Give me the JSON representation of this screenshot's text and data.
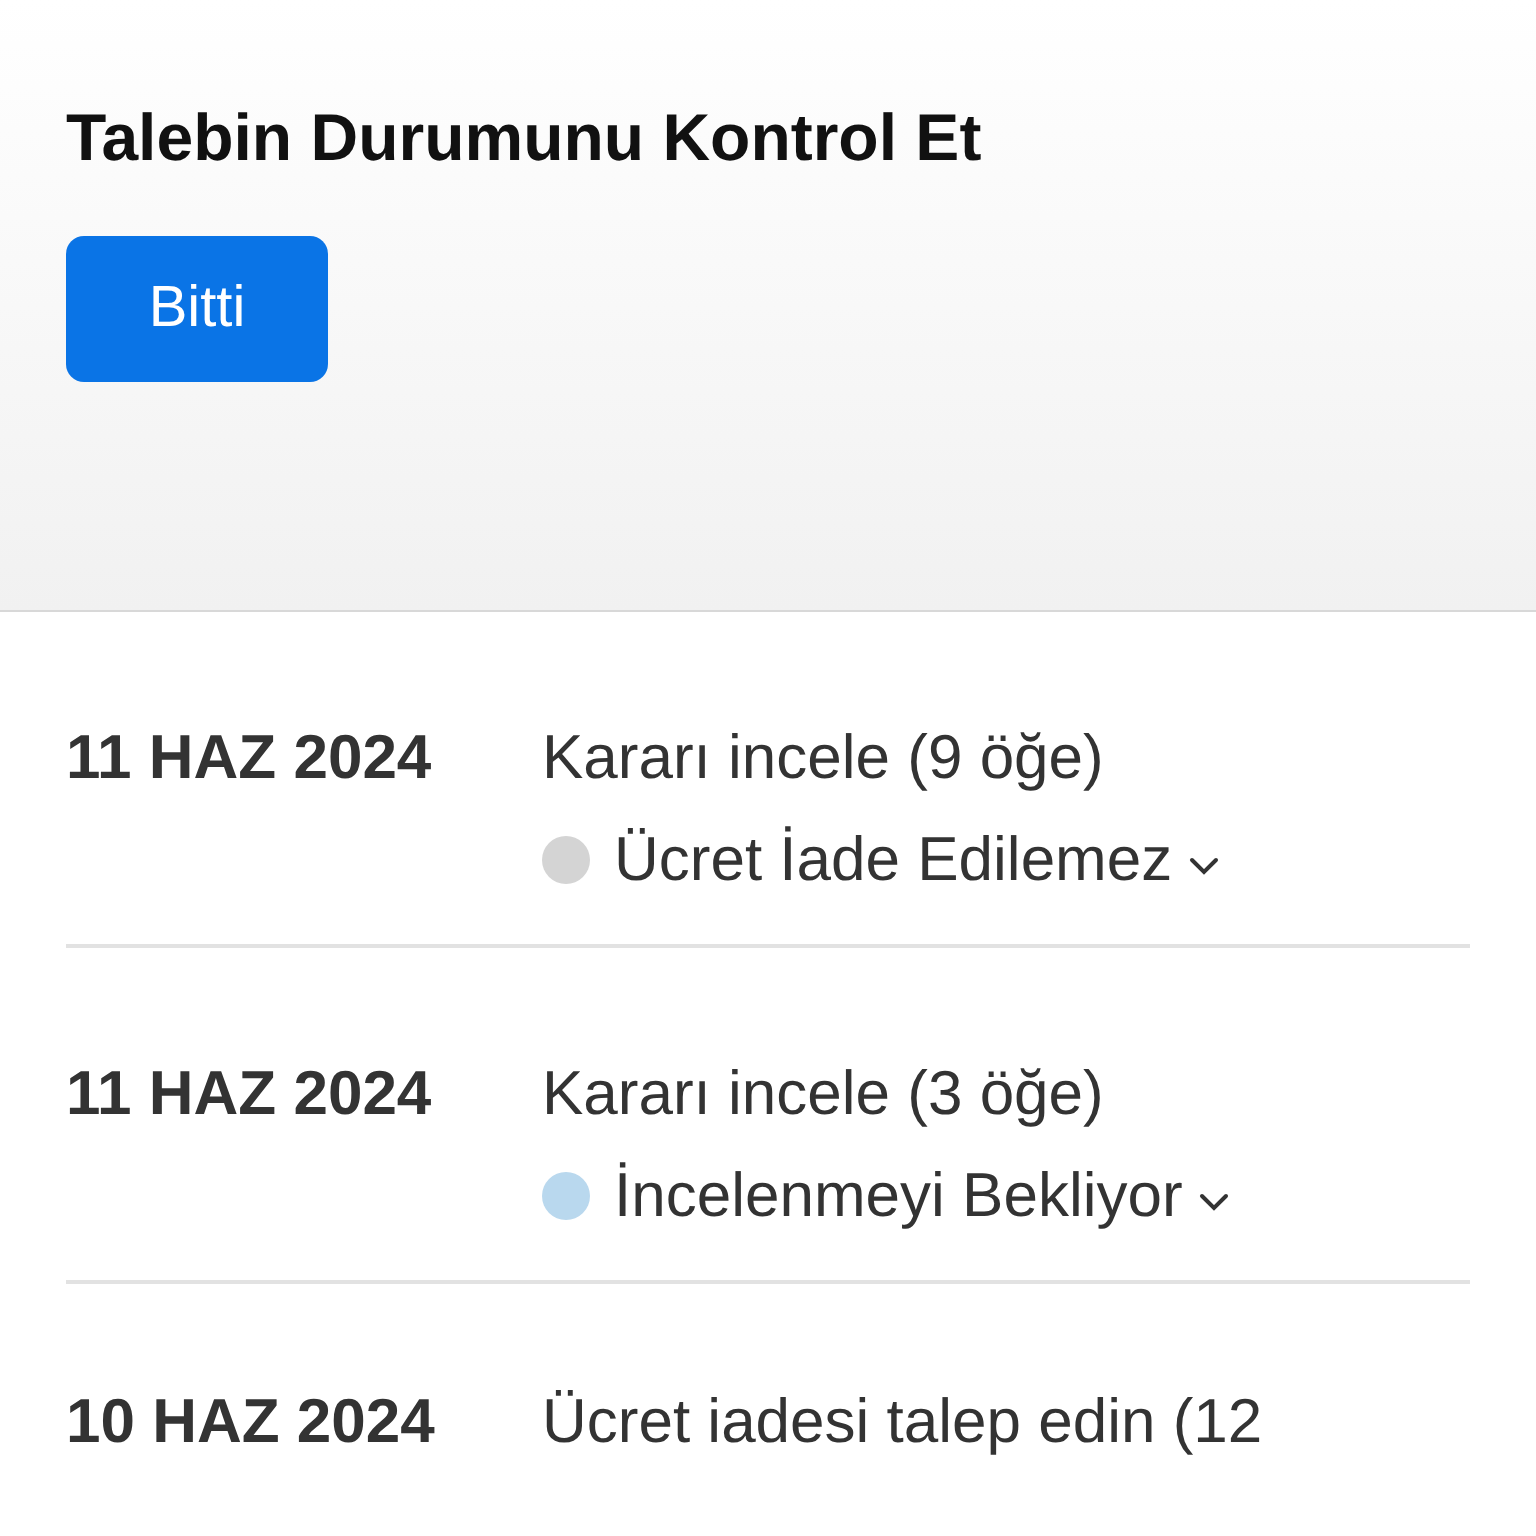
{
  "header": {
    "title": "Talebin Durumunu Kontrol Et",
    "done_button": "Bitti"
  },
  "requests": [
    {
      "date": "11 HAZ 2024",
      "title": "Kararı incele (9 öğe)",
      "status": {
        "label": "Ücret İade Edilemez",
        "color": "#d4d4d4"
      }
    },
    {
      "date": "11 HAZ 2024",
      "title": "Kararı incele (3 öğe)",
      "status": {
        "label": "İncelenmeyi Bekliyor",
        "color": "#b9d8ee"
      }
    },
    {
      "date": "10 HAZ 2024",
      "title": "Ücret iadesi talep edin (12"
    }
  ]
}
